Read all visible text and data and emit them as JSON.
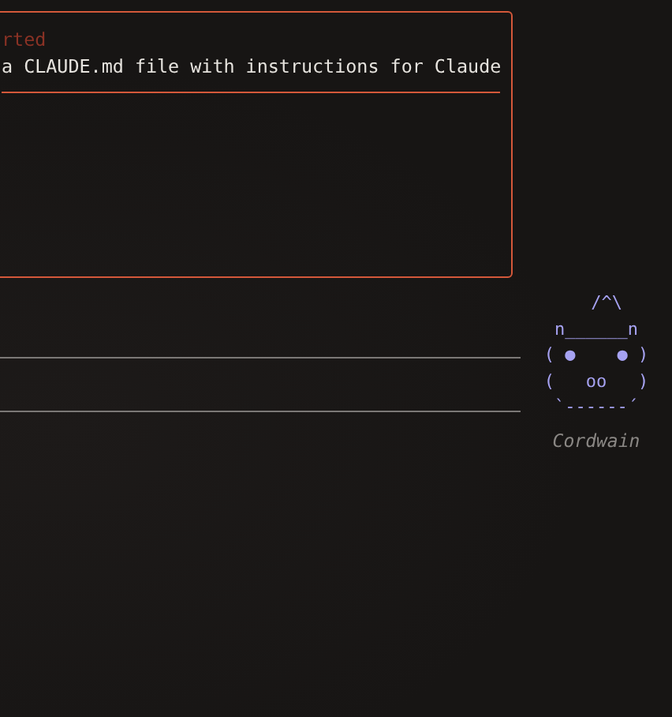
{
  "panel": {
    "status": "rted",
    "lines": [
      "a CLAUDE.md file with instructions for Claude"
    ]
  },
  "prompt": {
    "kind": "input"
  },
  "mascot": {
    "art": [
      "  /^\\",
      "n______n",
      "( ●    ● )",
      "(   oo   )",
      "`------´"
    ],
    "name": "Cordwain"
  }
}
